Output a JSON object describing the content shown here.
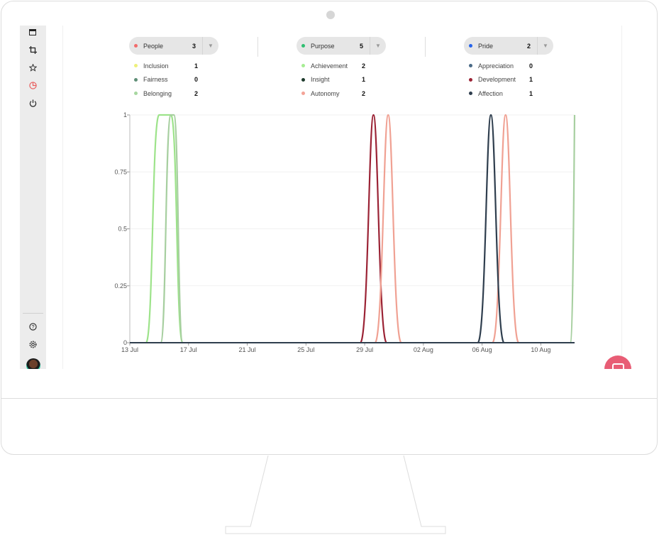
{
  "sidebar": {
    "icons": [
      "calendar-icon",
      "crop-icon",
      "star-icon",
      "chart-icon",
      "power-icon",
      "help-icon",
      "settings-icon"
    ],
    "active_color": "#e85d5d"
  },
  "groups": [
    {
      "label": "People",
      "count": "3",
      "color": "#f26b6b",
      "items": [
        {
          "label": "Inclusion",
          "count": "1",
          "color": "#eef07a"
        },
        {
          "label": "Fairness",
          "count": "0",
          "color": "#5f8f77"
        },
        {
          "label": "Belonging",
          "count": "2",
          "color": "#a7d7a0"
        }
      ]
    },
    {
      "label": "Purpose",
      "count": "5",
      "color": "#2fbf71",
      "items": [
        {
          "label": "Achievement",
          "count": "2",
          "color": "#a6ed93"
        },
        {
          "label": "Insight",
          "count": "1",
          "color": "#1d3a2b"
        },
        {
          "label": "Autonomy",
          "count": "2",
          "color": "#f4a397"
        }
      ]
    },
    {
      "label": "Pride",
      "count": "2",
      "color": "#2563eb",
      "items": [
        {
          "label": "Appreciation",
          "count": "0",
          "color": "#4a6a86"
        },
        {
          "label": "Development",
          "count": "1",
          "color": "#9b2335"
        },
        {
          "label": "Affection",
          "count": "1",
          "color": "#2f3e4e"
        }
      ]
    }
  ],
  "chart_data": {
    "type": "area",
    "x_ticks": [
      "13 Jul",
      "17 Jul",
      "21 Jul",
      "25 Jul",
      "29 Jul",
      "02 Aug",
      "06 Aug",
      "10 Aug"
    ],
    "y_ticks": [
      "0",
      "0.25",
      "0.5",
      "0.75",
      "1"
    ],
    "ylim": [
      0,
      1
    ],
    "xlim_days": [
      13.0,
      43.3
    ],
    "series": [
      {
        "name": "Achievement",
        "color": "#9de38a",
        "peaks": [
          {
            "start": 14.1,
            "end": 16.6,
            "plateau": [
              15.0,
              15.8
            ]
          }
        ]
      },
      {
        "name": "Belonging",
        "color": "#a7cfa0",
        "peaks": [
          {
            "start": 15.1,
            "end": 16.6,
            "plateau": [
              15.8,
              16.0
            ]
          },
          {
            "start": 43.0,
            "end": 43.3
          }
        ]
      },
      {
        "name": "Development",
        "color": "#9b2335",
        "peaks": [
          {
            "start": 28.7,
            "end": 30.5,
            "center": 29.6
          }
        ]
      },
      {
        "name": "Autonomy",
        "color": "#f0a193",
        "peaks": [
          {
            "start": 29.7,
            "end": 31.5,
            "center": 30.6
          },
          {
            "start": 37.7,
            "end": 39.5,
            "center": 38.6
          }
        ]
      },
      {
        "name": "Affection",
        "color": "#2f3e4e",
        "peaks": [
          {
            "start": 36.7,
            "end": 38.5,
            "center": 37.6
          }
        ]
      }
    ]
  },
  "fab": {
    "icon": "chat-icon",
    "color": "#e85d75"
  }
}
